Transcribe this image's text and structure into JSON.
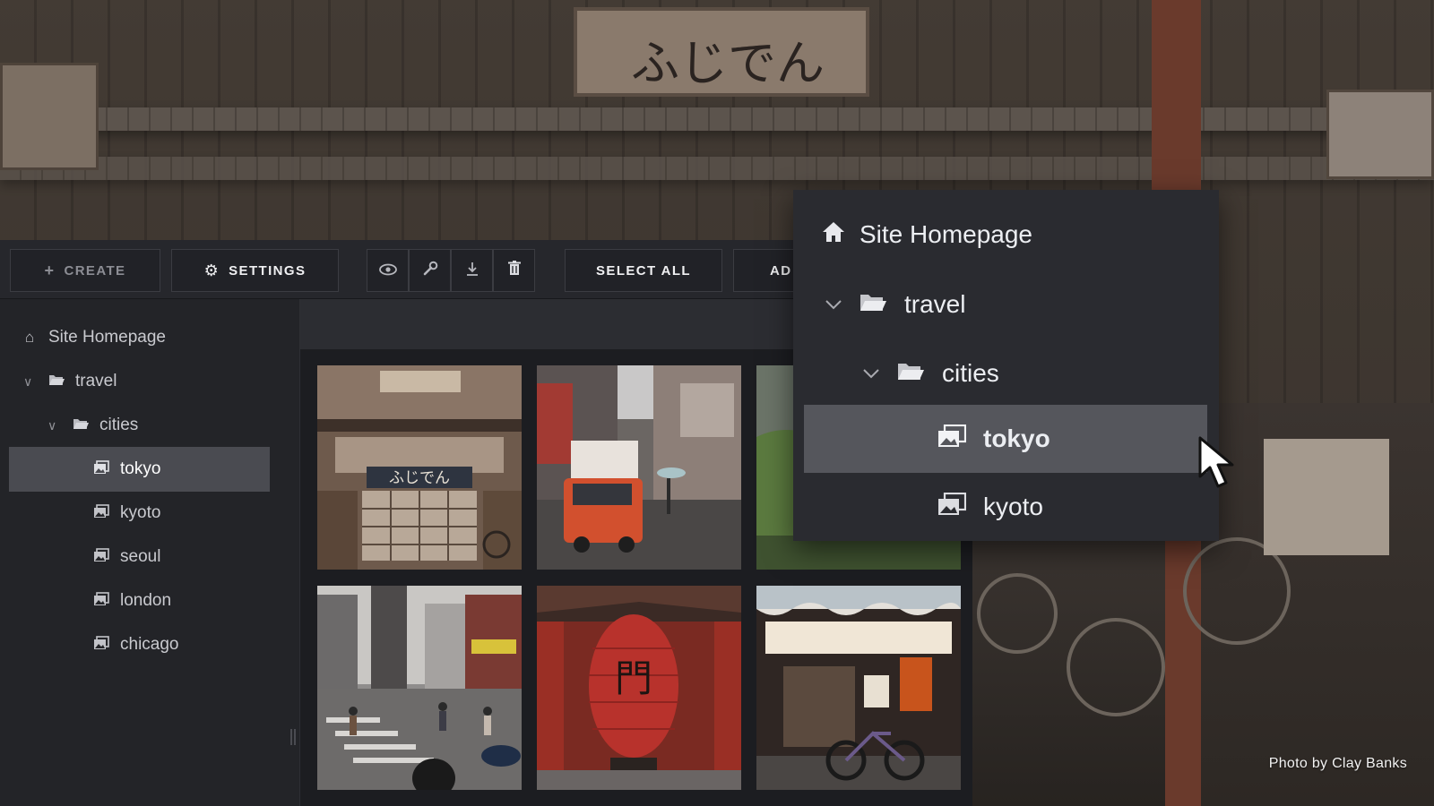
{
  "toolbar": {
    "create_label": "CREATE",
    "settings_label": "SETTINGS",
    "select_all_label": "SELECT ALL",
    "add_label_partial": "AD"
  },
  "sidebar": {
    "items": [
      {
        "label": "Site Homepage",
        "icon": "home-icon"
      },
      {
        "label": "travel",
        "icon": "folder-open-icon",
        "expanded": true
      },
      {
        "label": "cities",
        "icon": "folder-open-icon",
        "expanded": true
      },
      {
        "label": "tokyo",
        "icon": "gallery-icon",
        "selected": true
      },
      {
        "label": "kyoto",
        "icon": "gallery-icon"
      },
      {
        "label": "seoul",
        "icon": "gallery-icon"
      },
      {
        "label": "london",
        "icon": "gallery-icon"
      },
      {
        "label": "chicago",
        "icon": "gallery-icon"
      }
    ]
  },
  "popover": {
    "items": [
      {
        "label": "Site Homepage",
        "icon": "home-icon"
      },
      {
        "label": "travel",
        "icon": "folder-open-icon"
      },
      {
        "label": "cities",
        "icon": "folder-open-icon"
      },
      {
        "label": "tokyo",
        "icon": "gallery-icon",
        "selected": true
      },
      {
        "label": "kyoto",
        "icon": "gallery-icon"
      }
    ]
  },
  "background": {
    "shop_sign_text": "ふじでん"
  },
  "thumbnails": {
    "shop_sign_text": "ふじでん"
  },
  "photo_credit": "Photo by Clay Banks",
  "colors": {
    "app_bg": "#1f2024",
    "toolbar_bg": "#26272c",
    "sidebar_bg": "#232428",
    "selected_bg": "#4a4b51",
    "popover_bg": "#2a2b30"
  }
}
